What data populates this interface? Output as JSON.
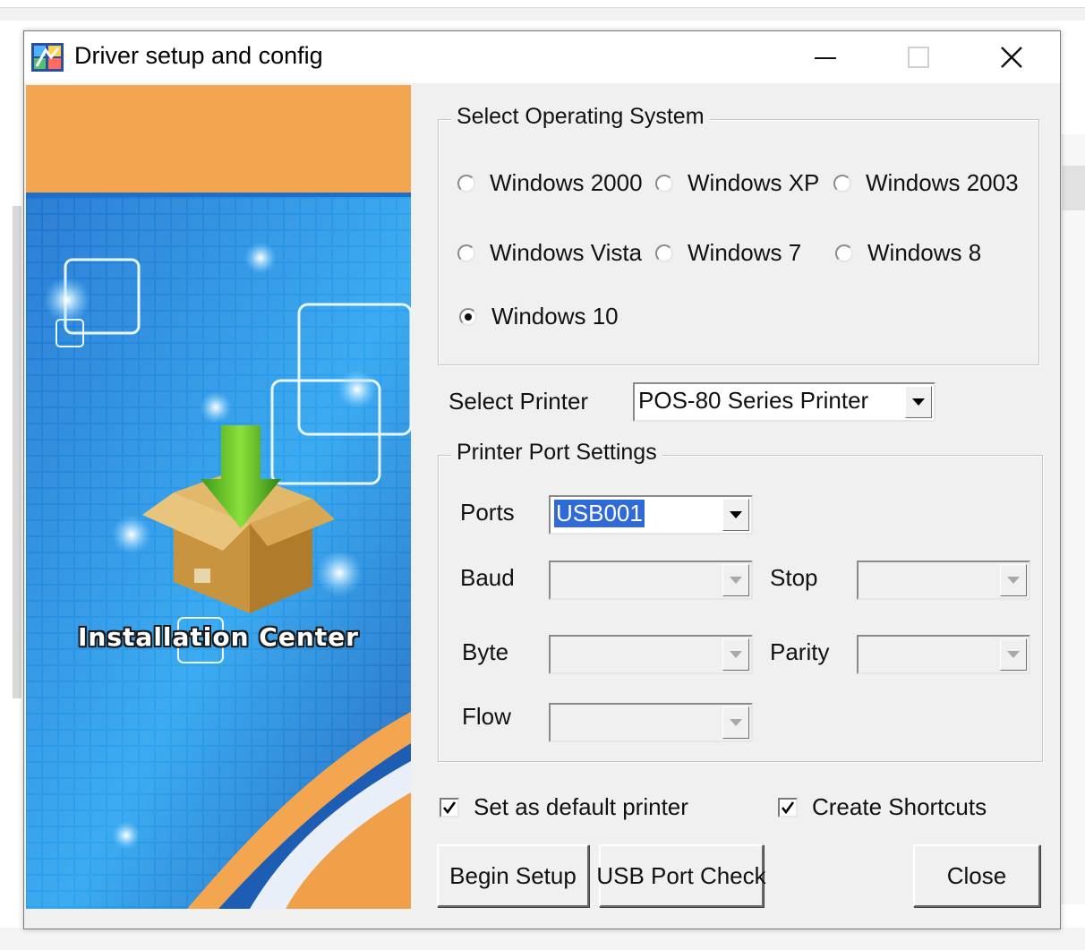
{
  "window": {
    "title": "Driver setup and config",
    "icon": "installer-app-icon",
    "controls": [
      "minimize",
      "maximize",
      "close"
    ]
  },
  "banner": {
    "label": "Installation Center",
    "colors": {
      "orange": "#f4a550",
      "blue": "#1e74d0",
      "highlight": "#2ea5f0"
    }
  },
  "os_group": {
    "title": "Select Operating System",
    "options": [
      {
        "label": "Windows 2000",
        "checked": false
      },
      {
        "label": "Windows XP",
        "checked": false
      },
      {
        "label": "Windows 2003",
        "checked": false
      },
      {
        "label": "Windows Vista",
        "checked": false
      },
      {
        "label": "Windows 7",
        "checked": false
      },
      {
        "label": "Windows 8",
        "checked": false
      },
      {
        "label": "Windows 10",
        "checked": true
      }
    ]
  },
  "printer": {
    "label": "Select Printer",
    "value": "POS-80 Series Printer"
  },
  "port_group": {
    "title": "Printer Port Settings",
    "ports_label": "Ports",
    "ports_value": "USB001",
    "baud_label": "Baud",
    "stop_label": "Stop",
    "byte_label": "Byte",
    "parity_label": "Parity",
    "flow_label": "Flow"
  },
  "options": {
    "default_printer": {
      "label": "Set as default printer",
      "checked": true
    },
    "shortcuts": {
      "label": "Create Shortcuts",
      "checked": true
    }
  },
  "buttons": {
    "begin_setup": "Begin Setup",
    "usb_check": "USB Port Check",
    "close": "Close"
  },
  "accent": "#2f6ad7"
}
